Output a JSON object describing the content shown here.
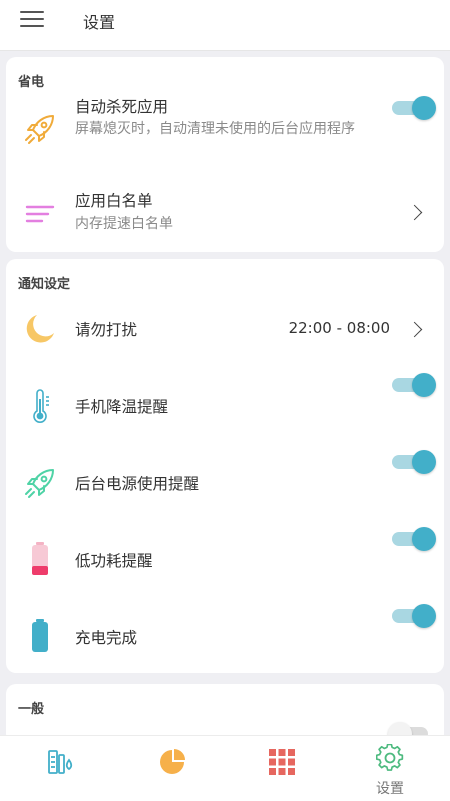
{
  "header": {
    "title": "设置"
  },
  "power_section": {
    "title": "省电",
    "items": [
      {
        "title": "自动杀死应用",
        "subtitle": "屏幕熄灭时，自动清理未使用的后台应用程序",
        "toggle": true
      },
      {
        "title": "应用白名单",
        "subtitle": "内存提速白名单"
      }
    ]
  },
  "notify_section": {
    "title": "通知设定",
    "dnd": {
      "title": "请勿打扰",
      "value": "22:00 - 08:00"
    },
    "items": [
      {
        "title": "手机降温提醒",
        "toggle": true
      },
      {
        "title": "后台电源使用提醒",
        "toggle": true
      },
      {
        "title": "低功耗提醒",
        "toggle": true
      },
      {
        "title": "充电完成",
        "toggle": true
      }
    ]
  },
  "general_section": {
    "title": "一般",
    "toggle": false
  },
  "bottom_nav": {
    "items": [
      {
        "icon": "battery-tools-icon"
      },
      {
        "icon": "pie-chart-icon"
      },
      {
        "icon": "apps-grid-icon"
      },
      {
        "icon": "gear-icon",
        "label": "设置",
        "active": true
      }
    ]
  },
  "colors": {
    "accent": "#42afc9",
    "background": "#efeff3",
    "rocket_orange": "#f0ab3a",
    "whitelist_pink": "#e37fe0",
    "moon": "#f7c766",
    "rocket_green": "#4fd3a6",
    "battery_red": "#ee3c6b",
    "grid_red": "#e6675f",
    "gear_green": "#4dba7f"
  }
}
